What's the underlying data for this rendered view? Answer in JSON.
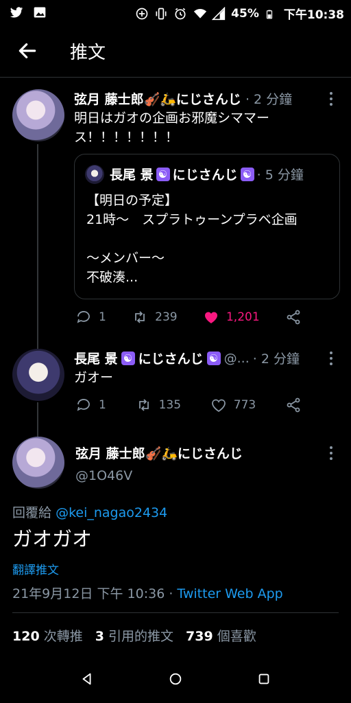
{
  "status_bar": {
    "battery": "45%",
    "time": "下午10:38"
  },
  "header": {
    "title": "推文"
  },
  "tweet1": {
    "name": "弦月 藤士郎🎻🛵にじさんじ",
    "time": "· 2 分鐘",
    "text1": "明日はガオの企画お邪魔シママー",
    "text2": "ス！！！！！！！",
    "quote": {
      "name": "長尾 景",
      "org": "にじさんじ",
      "time": "· 5 分鐘",
      "line1": "【明日の予定】",
      "line2": "21時〜　スプラトゥーンプラベ企画",
      "line3": "〜メンバー〜",
      "line4": "不破湊..."
    },
    "replies": "1",
    "retweets": "239",
    "likes": "1,201"
  },
  "tweet2": {
    "name": "長尾 景",
    "org": "にじさんじ",
    "handle": "@...",
    "time": "· 2 分鐘",
    "text": "ガオー",
    "replies": "1",
    "retweets": "135",
    "likes": "773"
  },
  "main_tweet": {
    "name": "弦月 藤士郎🎻🛵にじさんじ",
    "handle": "@1O46V",
    "reply_prefix": "回覆給",
    "reply_to": "@kei_nagao2434",
    "text": "ガオガオ",
    "translate": "翻譯推文",
    "date": "21年9月12日 下午 10:36 ·",
    "source": "Twitter Web App",
    "retweet_count": "120",
    "retweet_label": "次轉推",
    "quote_count": "3",
    "quote_label": "引用的推文",
    "like_count": "739",
    "like_label": "個喜歡"
  },
  "colors": {
    "accent": "#1d9bf0",
    "like": "#f91880",
    "muted": "#8b98a5"
  }
}
